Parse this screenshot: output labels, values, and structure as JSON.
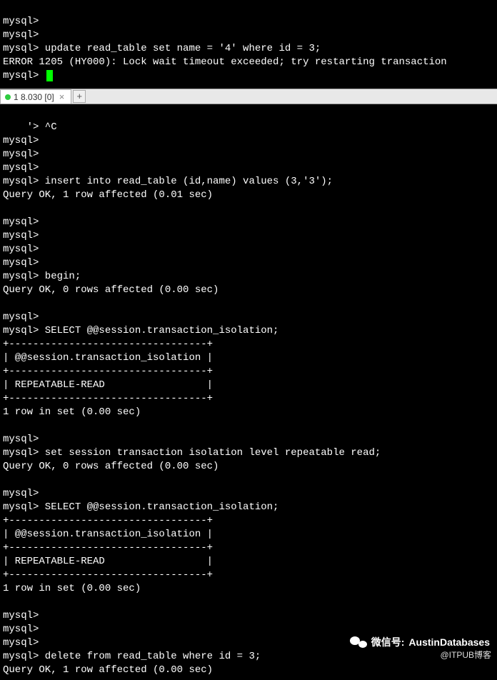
{
  "top_terminal": {
    "lines": [
      "mysql>",
      "mysql>",
      "mysql> update read_table set name = '4' where id = 3;",
      "ERROR 1205 (HY000): Lock wait timeout exceeded; try restarting transaction",
      "mysql> "
    ]
  },
  "tab": {
    "label": "1 8.030 [0]"
  },
  "bottom_terminal": {
    "lines": [
      "    '> ^C",
      "mysql>",
      "mysql>",
      "mysql>",
      "mysql> insert into read_table (id,name) values (3,'3');",
      "Query OK, 1 row affected (0.01 sec)",
      "",
      "mysql>",
      "mysql>",
      "mysql>",
      "mysql>",
      "mysql> begin;",
      "Query OK, 0 rows affected (0.00 sec)",
      "",
      "mysql>",
      "mysql> SELECT @@session.transaction_isolation;",
      "+---------------------------------+",
      "| @@session.transaction_isolation |",
      "+---------------------------------+",
      "| REPEATABLE-READ                 |",
      "+---------------------------------+",
      "1 row in set (0.00 sec)",
      "",
      "mysql>",
      "mysql> set session transaction isolation level repeatable read;",
      "Query OK, 0 rows affected (0.00 sec)",
      "",
      "mysql>",
      "mysql> SELECT @@session.transaction_isolation;",
      "+---------------------------------+",
      "| @@session.transaction_isolation |",
      "+---------------------------------+",
      "| REPEATABLE-READ                 |",
      "+---------------------------------+",
      "1 row in set (0.00 sec)",
      "",
      "mysql>",
      "mysql>",
      "mysql>",
      "mysql> delete from read_table where id = 3;",
      "Query OK, 1 row affected (0.00 sec)"
    ]
  },
  "watermark": {
    "label": "微信号:",
    "value": "AustinDatabases",
    "source": "@ITPUB博客"
  }
}
